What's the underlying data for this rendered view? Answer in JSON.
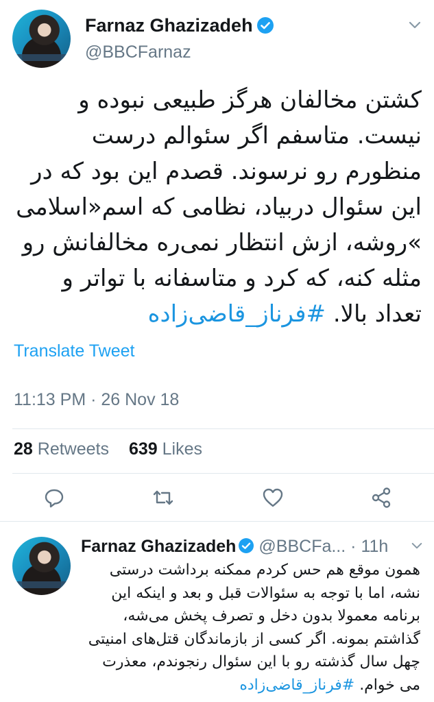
{
  "main_tweet": {
    "author_name": "Farnaz Ghazizadeh",
    "handle": "@BBCFarnaz",
    "text": "کشتن مخالفان هرگز طبیعی نبوده و نیست. متاسفم اگر سئوالم درست منظورم رو نرسوند. قصدم این بود که در این سئوال دربیاد، نظامی که اسم«اسلامی »روشه، ازش انتظار نمی‌ره مخالفانش رو مثله کنه، که کرد و متاسفانه با تواتر و تعداد بالا.",
    "hashtag": "#فرناز_قاضی‌زاده",
    "translate_label": "Translate Tweet",
    "timestamp": "11:13 PM · 26 Nov 18",
    "retweet_count": "28",
    "retweet_label": "Retweets",
    "like_count": "639",
    "like_label": "Likes"
  },
  "reply_tweet": {
    "author_name": "Farnaz Ghazizadeh",
    "handle": "@BBCFa...",
    "separator": "·",
    "time": "11h",
    "text": "همون موقع هم حس کردم ممکنه برداشت درستی نشه، اما با توجه به سئوالات قبل و بعد و اینکه این برنامه معمولا بدون دخل و تصرف پخش می‌شه، گذاشتم بمونه. اگر کسی از بازماندگان قتل‌های امنیتی چهل سال گذشته رو با این سئوال رنجوندم، معذرت می خوام.",
    "hashtag": "#فرناز_قاضی‌زاده"
  },
  "icons": {
    "verified": "verified-badge-icon",
    "chevron": "chevron-down-icon",
    "reply": "reply-icon",
    "retweet": "retweet-icon",
    "like": "heart-icon",
    "share": "share-icon"
  },
  "colors": {
    "accent": "#1da1f2",
    "hashtag": "#1b95e0",
    "secondary_text": "#657786",
    "primary_text": "#14171a",
    "divider": "#e1e8ed"
  }
}
